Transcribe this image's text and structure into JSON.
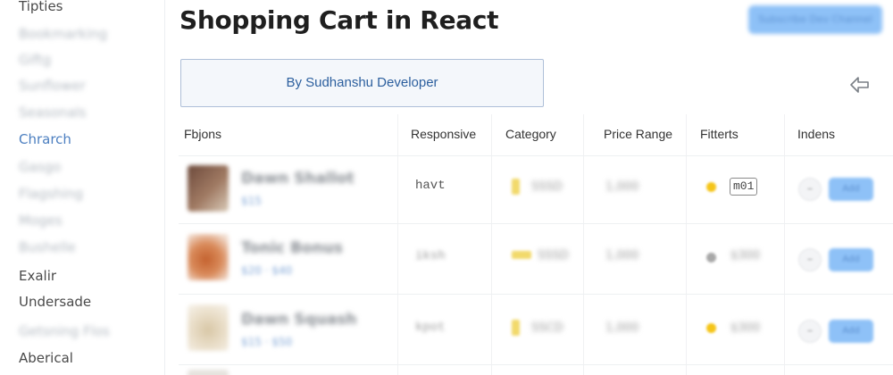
{
  "sidebar": {
    "items": [
      {
        "label": "Tipties",
        "state": "clear"
      },
      {
        "label": "Bookmarking",
        "state": "blurred"
      },
      {
        "label": "Giftg",
        "state": "blurred"
      },
      {
        "label": "Sunflower",
        "state": "blurred"
      },
      {
        "label": "Seasonals",
        "state": "blurred"
      },
      {
        "label": "Chrarch",
        "state": "active"
      },
      {
        "label": "Gasgo",
        "state": "blurred"
      },
      {
        "label": "Flagshing",
        "state": "blurred"
      },
      {
        "label": "Moges",
        "state": "blurred"
      },
      {
        "label": "Bushelle",
        "state": "blurred"
      },
      {
        "label": "Exalir",
        "state": "clear"
      },
      {
        "label": "Undersade",
        "state": "clear"
      },
      {
        "label": "Getsning Flos",
        "state": "blurred"
      },
      {
        "label": "Aberical",
        "state": "clear"
      }
    ]
  },
  "header": {
    "title": "Shopping Cart in React",
    "top_button_label": "Subscribe Dev Channel"
  },
  "byline": "By Sudhanshu Developer",
  "icons": {
    "share": "share-arrow-icon",
    "category_swatch": "category-swatch-icon",
    "filter_dot": "filter-dot-icon"
  },
  "colors": {
    "accent": "#8ec1f7",
    "link": "#2c5f9e",
    "active_nav": "#4c7fc0",
    "swatch_yellow": "#f2d96a",
    "dot_yellow": "#f5c518",
    "dot_gray": "#a8a8a8"
  },
  "table": {
    "columns": [
      "Fbjons",
      "Responsive",
      "Category",
      "Price Range",
      "Fitterts",
      "Indens"
    ],
    "rows": [
      {
        "name": "Dawn Shallot",
        "sub": "$15",
        "responsive": "havt",
        "responsive_clear": true,
        "category": "SSSD",
        "price": "1,000",
        "filter_badge": "m01",
        "filter_value": "",
        "minus": "–",
        "add": "Add"
      },
      {
        "name": "Tonic Bonus",
        "sub": "$20 · $40",
        "responsive": "iksh",
        "responsive_clear": false,
        "category": "SSSD",
        "price": "1,000",
        "filter_badge": "",
        "filter_value": "$300",
        "minus": "–",
        "add": "Add"
      },
      {
        "name": "Dawn Squash",
        "sub": "$15 · $50",
        "responsive": "kpot",
        "responsive_clear": false,
        "category": "SSCD",
        "price": "1,000",
        "filter_badge": "",
        "filter_value": "$300",
        "minus": "–",
        "add": "Add"
      }
    ]
  }
}
